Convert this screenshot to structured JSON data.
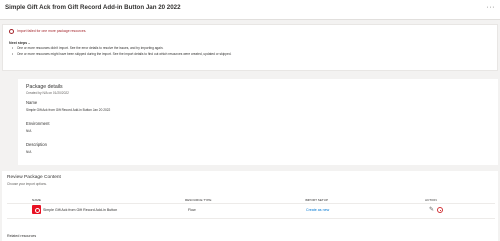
{
  "header": {
    "title": "Simple Gift Ack from Gift Record Add-in Button Jan 20 2022",
    "menu_icon": "more-horizontal-icon"
  },
  "alert": {
    "message": "Import failed for one more package resources.",
    "next_steps_label": "Next steps –",
    "steps": [
      "One or more resources didn't import. See the error details to resolve the issues, and try importing again.",
      "One or more resources might have been skipped during the import. See the import details to find out which resources were created, updated or skipped."
    ],
    "icon": "error-circle-icon",
    "color": "#a4262c"
  },
  "details": {
    "title": "Package details",
    "created": "Created by N/A on 01/20/2022",
    "name_label": "Name",
    "name_value": "Simple Gift Ack from Gift Record Add-in Button Jan 20 2022",
    "env_label": "Environment",
    "env_value": "N/A",
    "desc_label": "Description",
    "desc_value": "N/A"
  },
  "review": {
    "title": "Review Package Content",
    "subtitle": "Choose your import options.",
    "columns": [
      "NAME",
      "RESOURCE TYPE",
      "IMPORT SETUP",
      "ACTION"
    ],
    "rows": [
      {
        "name": "Simple Gift Ack from Gift Record Add-in Button",
        "type": "Flow",
        "setup": "Create as new",
        "icon": "flow-resource-icon"
      }
    ],
    "related": "Related resources"
  },
  "colors": {
    "accent": "#0078d4",
    "error": "#d13438",
    "resource_icon_bg": "#e81123"
  }
}
